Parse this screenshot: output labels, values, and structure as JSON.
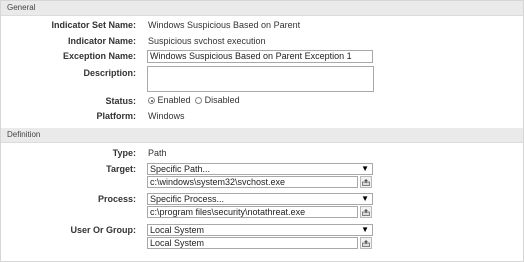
{
  "general": {
    "section_title": "General",
    "indicator_set_name_label": "Indicator Set Name:",
    "indicator_set_name_value": "Windows Suspicious Based on Parent",
    "indicator_name_label": "Indicator Name:",
    "indicator_name_value": "Suspicious svchost execution",
    "exception_name_label": "Exception Name:",
    "exception_name_value": "Windows Suspicious Based on Parent Exception 1",
    "description_label": "Description:",
    "description_value": "",
    "status_label": "Status:",
    "status_options": [
      "Enabled",
      "Disabled"
    ],
    "status_selected": "Enabled",
    "platform_label": "Platform:",
    "platform_value": "Windows"
  },
  "definition": {
    "section_title": "Definition",
    "type_label": "Type:",
    "type_value": "Path",
    "target_label": "Target:",
    "target_select": "Specific Path...",
    "target_path": "c:\\windows\\system32\\svchost.exe",
    "process_label": "Process:",
    "process_select": "Specific Process...",
    "process_path": "c:\\program files\\security\\notathreat.exe",
    "user_group_label": "User Or Group:",
    "user_group_select": "Local System",
    "user_group_value": "Local System"
  },
  "icons": {
    "dropdown_arrow": "triangle-down",
    "browse": "browse-icon"
  }
}
